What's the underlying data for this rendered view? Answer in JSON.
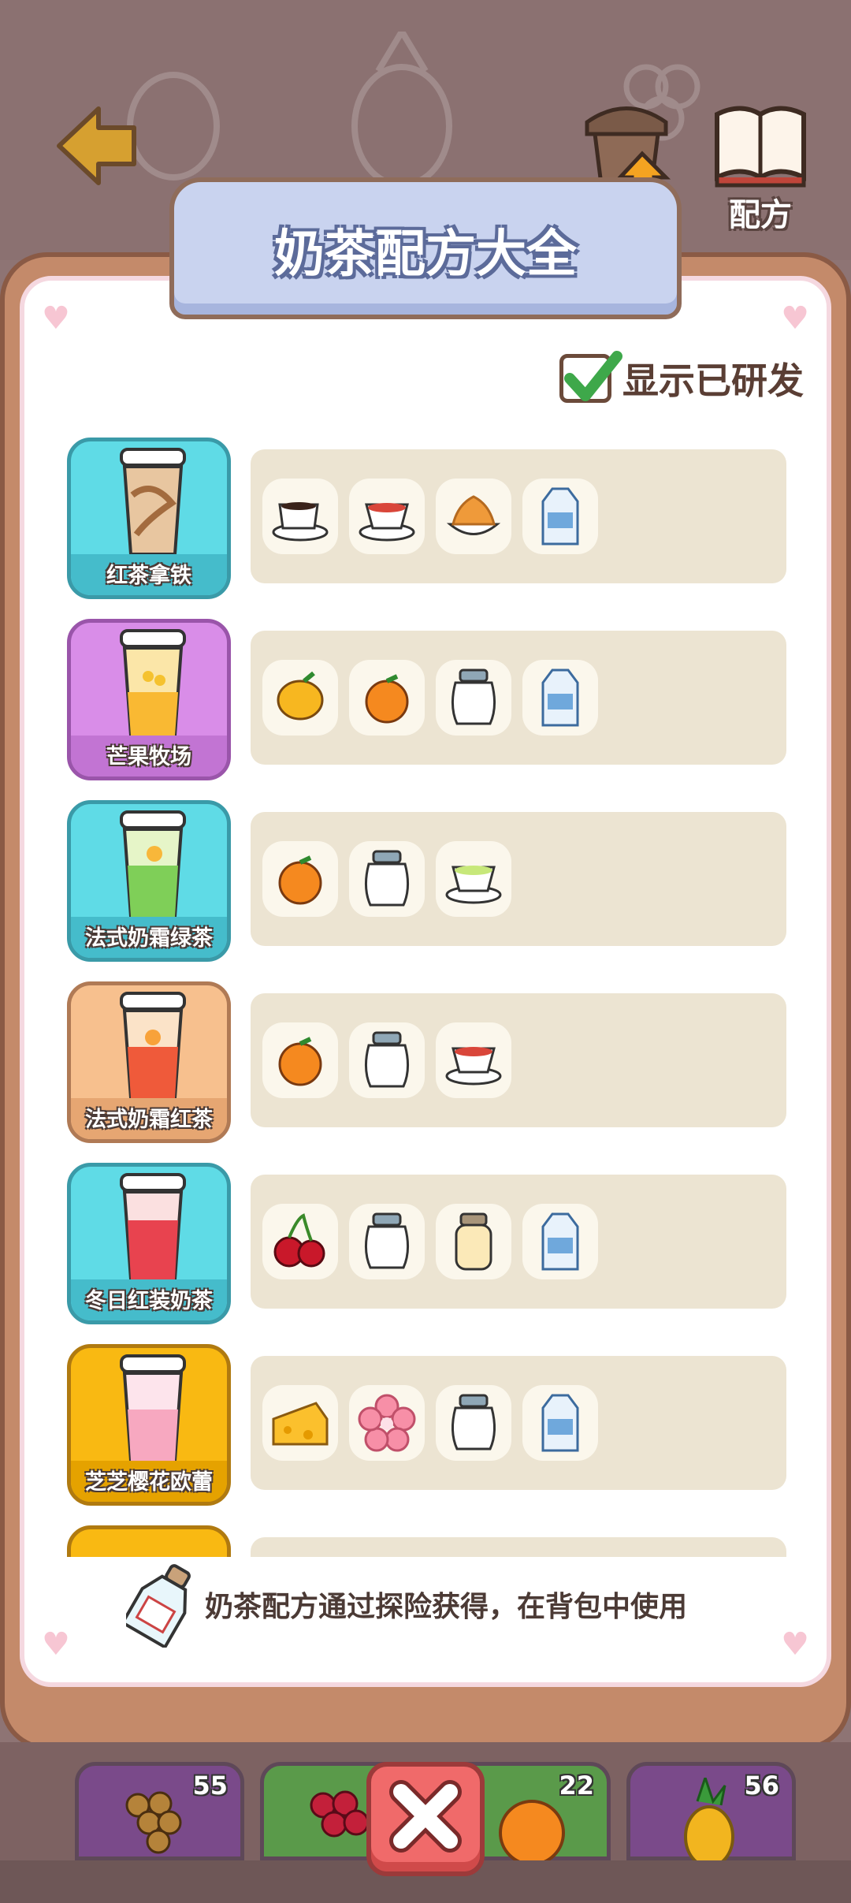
{
  "header": {
    "upgrade_label": "升级",
    "recipe_button_label": "配方"
  },
  "panel": {
    "title": "奶茶配方大全",
    "show_researched_label": "显示已研发",
    "show_researched_checked": true,
    "footer_note": "奶茶配方通过探险获得，在背包中使用"
  },
  "recipes": [
    {
      "name": "红茶拿铁",
      "card_color": "#5fdbe6",
      "ingredients": [
        "coffee-cup-icon",
        "black-tea-cup-icon",
        "caramel-cream-icon",
        "milk-carton-icon"
      ]
    },
    {
      "name": "芒果牧场",
      "card_color": "#d98de8",
      "ingredients": [
        "mango-icon",
        "orange-icon",
        "cream-jar-icon",
        "milk-carton-icon"
      ]
    },
    {
      "name": "法式奶霜绿茶",
      "card_color": "#5fdbe6",
      "ingredients": [
        "orange-icon",
        "cream-jar-icon",
        "green-tea-cup-icon"
      ]
    },
    {
      "name": "法式奶霜红茶",
      "card_color": "#f7c08e",
      "ingredients": [
        "orange-icon",
        "cream-jar-icon",
        "black-tea-cup-icon"
      ]
    },
    {
      "name": "冬日红装奶茶",
      "card_color": "#5fdbe6",
      "ingredients": [
        "cherry-icon",
        "cream-jar-icon",
        "yogurt-jar-icon",
        "milk-carton-icon"
      ]
    },
    {
      "name": "芝芝樱花欧蕾",
      "card_color": "#f9b912",
      "ingredients": [
        "cheese-icon",
        "sakura-icon",
        "cream-jar-icon",
        "milk-carton-icon"
      ]
    }
  ],
  "bottom_tabs": [
    {
      "item": "grape-bunch-icon",
      "count": "55"
    },
    {
      "item": "red-grape-icon",
      "count": ""
    },
    {
      "item": "orange-icon",
      "count": "22"
    },
    {
      "item": "pineapple-icon",
      "count": "56"
    }
  ]
}
